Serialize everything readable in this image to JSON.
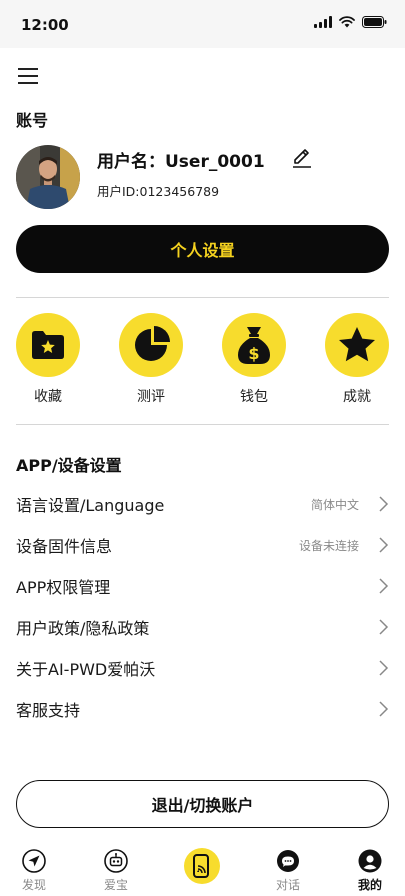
{
  "status_bar": {
    "time": "12:00"
  },
  "account": {
    "section_title": "账号",
    "username": "用户名：User_0001",
    "user_id": "用户ID:0123456789",
    "settings_button": "个人设置"
  },
  "quick_actions": [
    {
      "label": "收藏",
      "icon": "folder-star-icon"
    },
    {
      "label": "测评",
      "icon": "pie-chart-icon"
    },
    {
      "label": "钱包",
      "icon": "money-bag-icon"
    },
    {
      "label": "成就",
      "icon": "star-icon"
    }
  ],
  "settings": {
    "section_title": "APP/设备设置",
    "rows": [
      {
        "label": "语言设置/Language",
        "value": "简体中文"
      },
      {
        "label": "设备固件信息",
        "value": "设备未连接"
      },
      {
        "label": "APP权限管理",
        "value": ""
      },
      {
        "label": "用户政策/隐私政策",
        "value": ""
      },
      {
        "label": "关于AI-PWD爱帕沃",
        "value": ""
      },
      {
        "label": "客服支持",
        "value": ""
      }
    ]
  },
  "logout_button": "退出/切换账户",
  "tab_bar": {
    "tabs": [
      {
        "label": "发现",
        "icon": "paper-plane-icon"
      },
      {
        "label": "爱宝",
        "icon": "robot-icon"
      },
      {
        "label": "",
        "icon": "device-cast-icon"
      },
      {
        "label": "对话",
        "icon": "chat-bubble-icon"
      },
      {
        "label": "我的",
        "icon": "user-icon"
      }
    ],
    "active": "我的"
  },
  "colors": {
    "accent": "#f7dc2d",
    "primary": "#0a0a0a",
    "muted": "#8a8a8a"
  }
}
